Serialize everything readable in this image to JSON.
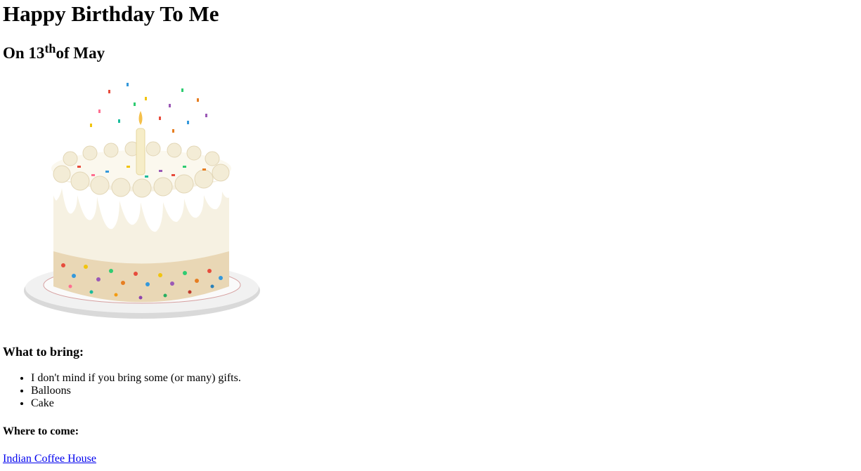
{
  "heading": {
    "title": "Happy Birthday To Me",
    "date_prefix": "On 13",
    "date_suffix": "th",
    "date_rest": "of May"
  },
  "image": {
    "alt": "Birthday cake with candle and sprinkles"
  },
  "bring": {
    "title": "What to bring:",
    "items": [
      "I don't mind if you bring some (or many) gifts.",
      "Balloons",
      "Cake"
    ]
  },
  "where": {
    "title": "Where to come:",
    "link_text": "Indian Coffee House"
  },
  "colors": {
    "link": "#0000ee",
    "frosting": "#f7f3e4",
    "plate": "#eeeeee"
  }
}
